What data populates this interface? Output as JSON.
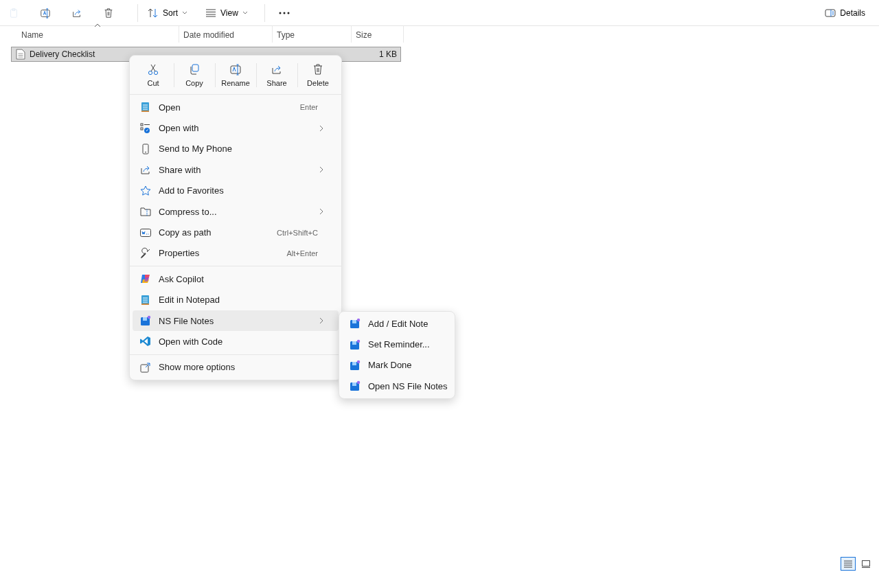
{
  "toolbar": {
    "icon_buttons": [
      {
        "disabled": true
      },
      {
        "disabled": false
      },
      {
        "disabled": false
      },
      {
        "disabled": false
      }
    ],
    "sort": "Sort",
    "view": "View",
    "details": "Details"
  },
  "table": {
    "columns": [
      "Name",
      "Date modified",
      "Type",
      "Size"
    ],
    "rows": [
      {
        "name": "Delivery Checklist",
        "size": "1 KB",
        "selected": true
      }
    ]
  },
  "context_menu": {
    "actions": [
      "Cut",
      "Copy",
      "Rename",
      "Share",
      "Delete"
    ],
    "groups": [
      [
        {
          "label": "Open",
          "shortcut": "Enter",
          "submenu": false,
          "highlighted": false
        },
        {
          "label": "Open with",
          "submenu": true,
          "highlighted": false
        },
        {
          "label": "Send to My Phone",
          "submenu": false,
          "highlighted": false
        },
        {
          "label": "Share with",
          "submenu": true,
          "highlighted": false
        },
        {
          "label": "Add to Favorites",
          "submenu": false,
          "highlighted": false
        },
        {
          "label": "Compress to...",
          "submenu": true,
          "highlighted": false
        },
        {
          "label": "Copy as path",
          "shortcut": "Ctrl+Shift+C",
          "submenu": false,
          "highlighted": false
        },
        {
          "label": "Properties",
          "shortcut": "Alt+Enter",
          "submenu": false,
          "highlighted": false
        }
      ],
      [
        {
          "label": "Ask Copilot",
          "submenu": false,
          "highlighted": false
        },
        {
          "label": "Edit in Notepad",
          "submenu": false,
          "highlighted": false
        },
        {
          "label": "NS File Notes",
          "submenu": true,
          "highlighted": true
        },
        {
          "label": "Open with Code",
          "submenu": false,
          "highlighted": false
        }
      ],
      [
        {
          "label": "Show more options",
          "submenu": false,
          "highlighted": false
        }
      ]
    ]
  },
  "submenu": {
    "items": [
      "Add / Edit Note",
      "Set Reminder...",
      "Mark Done",
      "Open NS File Notes"
    ]
  },
  "view_buttons": [
    {
      "selected": true
    },
    {
      "selected": false
    }
  ]
}
